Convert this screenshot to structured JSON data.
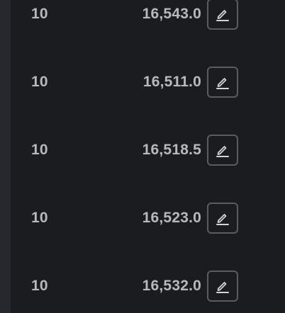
{
  "rows": [
    {
      "qty": "10",
      "price": "16,543.0",
      "icon": "pencil-icon"
    },
    {
      "qty": "10",
      "price": "16,511.0",
      "icon": "pencil-icon"
    },
    {
      "qty": "10",
      "price": "16,518.5",
      "icon": "pencil-icon"
    },
    {
      "qty": "10",
      "price": "16,523.0",
      "icon": "pencil-icon"
    },
    {
      "qty": "10",
      "price": "16,532.0",
      "icon": "pencil-icon"
    }
  ],
  "colors": {
    "background": "#1b1c20",
    "text": "#b7b9be",
    "button_border": "#5a5c62",
    "left_strip": "#27282d"
  }
}
